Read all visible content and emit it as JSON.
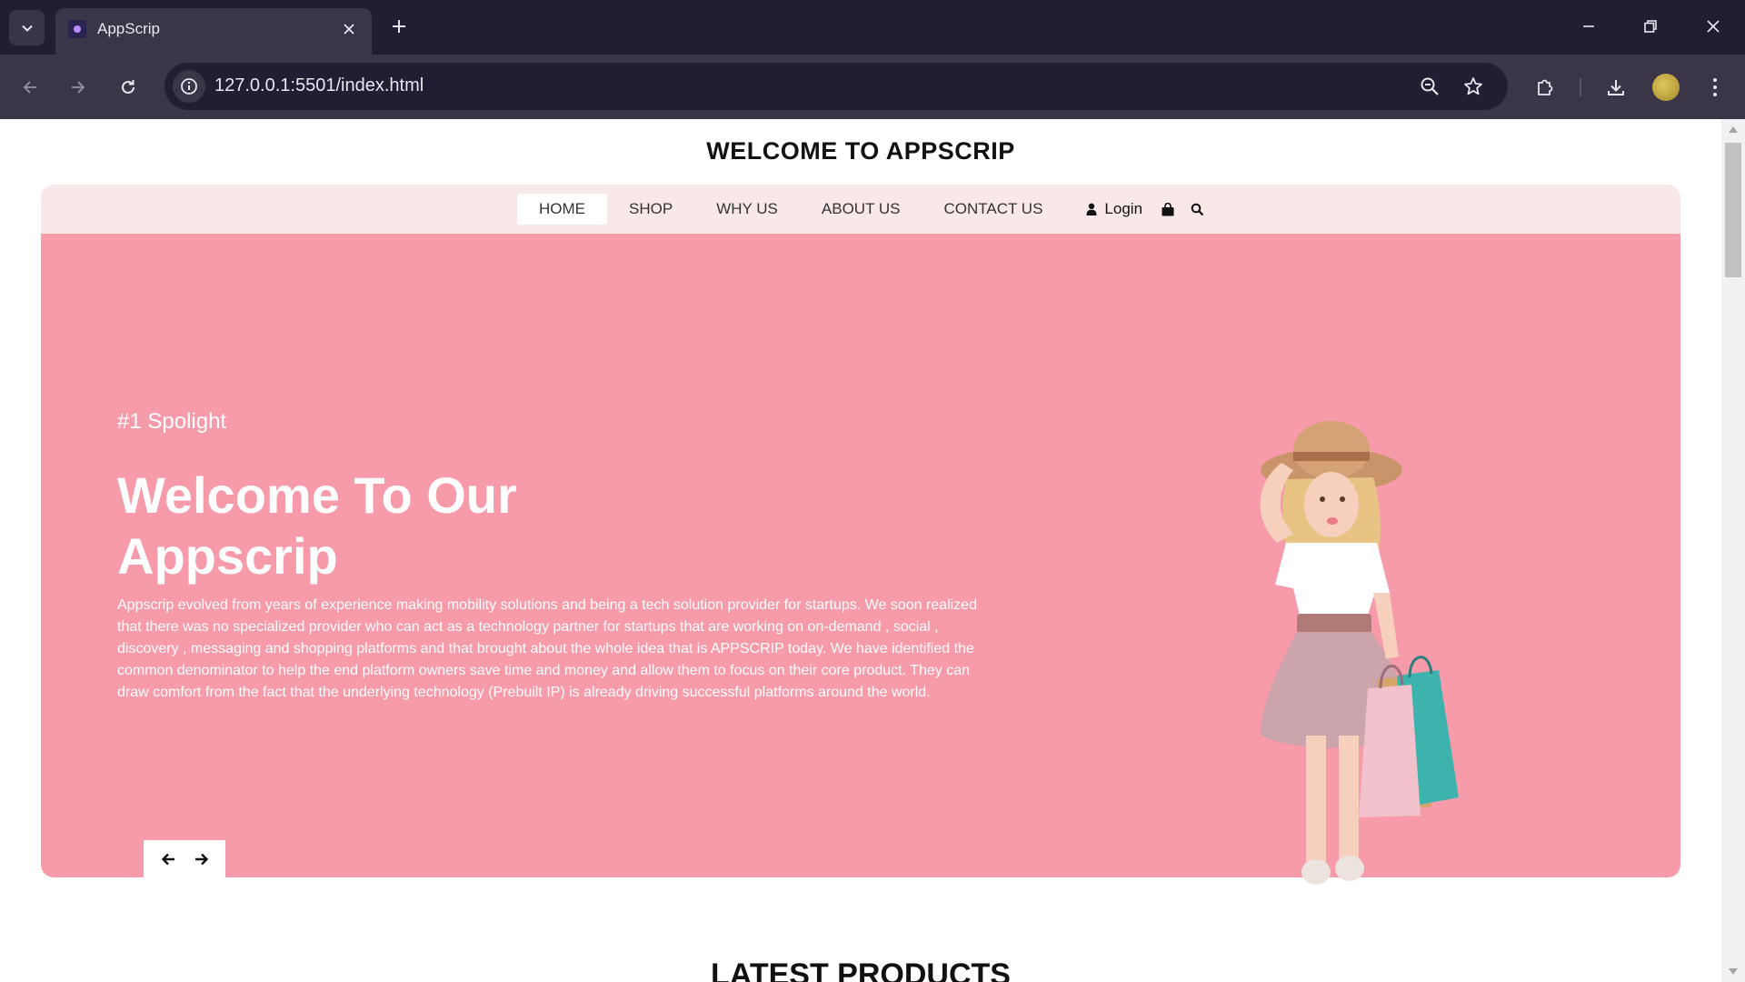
{
  "browser": {
    "tab_title": "AppScrip",
    "url": "127.0.0.1:5501/index.html"
  },
  "page": {
    "site_title": "WELCOME TO APPSCRIP",
    "nav": {
      "items": [
        "HOME",
        "SHOP",
        "WHY US",
        "ABOUT US",
        "CONTACT US"
      ],
      "active": "HOME",
      "login_label": "Login"
    },
    "hero": {
      "tagline": "#1 Spolight",
      "heading": "Welcome To Our Appscrip",
      "body": "Appscrip evolved from years of experience making mobility solutions and being a tech solution provider for startups. We soon realized that there was no specialized provider who can act as a technology partner for startups that are working on on-demand , social , discovery , messaging and shopping platforms and that brought about the whole idea that is APPSCRIP today. We have identified the common denominator to help the end platform owners save time and money and allow them to focus on their core product. They can draw comfort from the fact that the underlying technology (Prebuilt IP) is already driving successful platforms around the world.",
      "background_color": "#f79aa9"
    },
    "section_title": "LATEST PRODUCTS"
  },
  "icons": {
    "tab_search": "chevron-down-icon",
    "new_tab": "plus-icon",
    "back": "arrow-left-icon",
    "forward": "arrow-right-icon",
    "reload": "reload-icon",
    "site_info": "info-icon",
    "zoom": "zoom-out-icon",
    "bookmark": "star-icon",
    "extensions": "puzzle-icon",
    "downloads": "download-icon",
    "menu": "kebab-menu-icon",
    "login": "user-icon",
    "cart": "shopping-bag-icon",
    "search": "search-icon",
    "prev": "arrow-left-icon",
    "next": "arrow-right-icon"
  },
  "colors": {
    "chrome_dark": "#221d32",
    "chrome_toolbar": "#3b3548",
    "navbar_bg": "#f8e9e8",
    "hero_bg": "#f79aa9"
  }
}
